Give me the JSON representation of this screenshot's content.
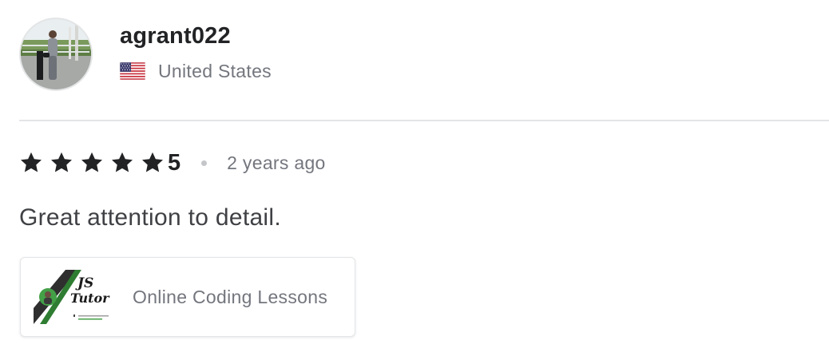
{
  "reviewer": {
    "username": "agrant022",
    "country": "United States",
    "flag_icon": "us-flag-icon"
  },
  "review": {
    "rating_stars": 5,
    "rating_label": "5",
    "time_ago": "2 years ago",
    "text": "Great attention to detail.",
    "star_color": "#222325"
  },
  "gig": {
    "title": "Online Coding Lessons",
    "thumbnail_text_line1": "JS",
    "thumbnail_text_line2": "Tutor",
    "thumbnail_accent": "#2e7d32"
  },
  "colors": {
    "text_primary": "#222325",
    "text_secondary": "#74767e",
    "divider": "#e4e5e7"
  }
}
